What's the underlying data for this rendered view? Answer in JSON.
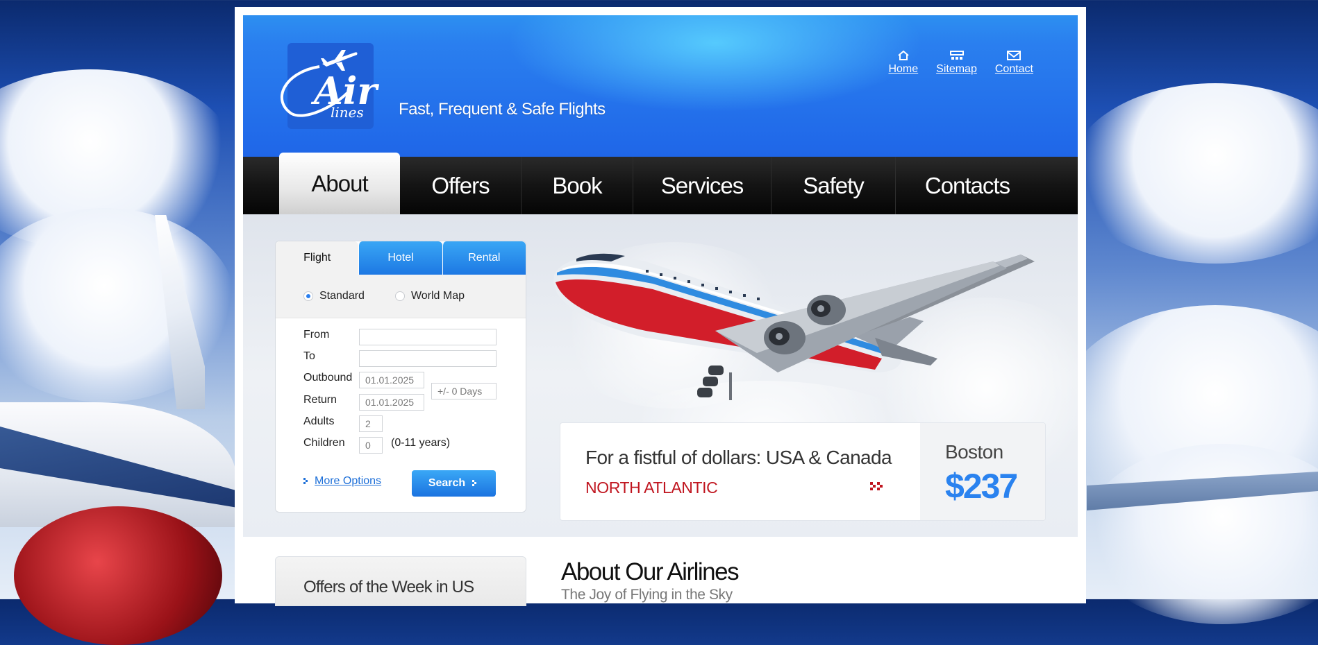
{
  "header": {
    "logo_text": "Air",
    "logo_subtext": "lines",
    "tagline": "Fast, Frequent & Safe Flights",
    "toplinks": [
      {
        "label": "Home",
        "icon": "home-icon"
      },
      {
        "label": "Sitemap",
        "icon": "sitemap-icon"
      },
      {
        "label": "Contact",
        "icon": "envelope-icon"
      }
    ]
  },
  "nav": {
    "items": [
      "About",
      "Offers",
      "Book",
      "Services",
      "Safety",
      "Contacts"
    ],
    "active": "About"
  },
  "search": {
    "tabs": [
      "Flight",
      "Hotel",
      "Rental"
    ],
    "active_tab": "Flight",
    "radios": [
      {
        "label": "Standard",
        "checked": true
      },
      {
        "label": "World Map",
        "checked": false
      }
    ],
    "fields": {
      "from_label": "From",
      "from_value": "",
      "to_label": "To",
      "to_value": "",
      "outbound_label": "Outbound",
      "outbound_value": "01.01.2025",
      "return_label": "Return",
      "return_value": "01.01.2025",
      "flex_days": "+/- 0 Days",
      "adults_label": "Adults",
      "adults_value": "2",
      "children_label": "Children",
      "children_value": "0",
      "children_note": "(0-11 years)"
    },
    "more_options": "More Options",
    "search_button": "Search"
  },
  "offer": {
    "title": "For a fistful of dollars: USA & Canada",
    "region": "NORTH ATLANTIC",
    "city": "Boston",
    "price": "$237"
  },
  "lower": {
    "offers_title": "Offers of the Week in US",
    "about_title": "About Our Airlines",
    "about_subtitle": "The Joy of Flying in the Sky"
  },
  "colors": {
    "brand_blue": "#2a7fef",
    "accent_red": "#c0151f",
    "nav_black": "#141414"
  }
}
